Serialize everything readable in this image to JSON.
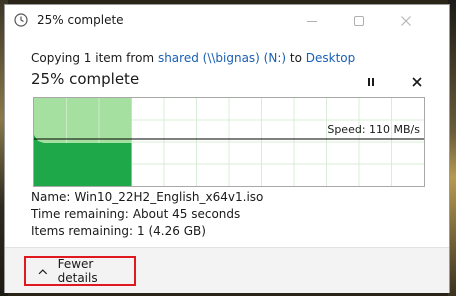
{
  "window": {
    "title": "25% complete",
    "controls": {
      "minimize_icon": "minimize-icon",
      "maximize_icon": "maximize-icon",
      "close_icon": "close-icon"
    }
  },
  "copy": {
    "prefix": "Copying 1 item from ",
    "source": "shared (\\\\bignas) (N:)",
    "middle": " to ",
    "destination": "Desktop",
    "progress_text": "25% complete",
    "progress_fraction": 0.25,
    "pause_icon": "pause-icon",
    "cancel_icon": "cancel-icon"
  },
  "graph": {
    "speed_label": "Speed: 110 MB/s",
    "colors": {
      "done": "#a6e0a0",
      "throughput": "#1ea84a",
      "grid": "#d9ecd7",
      "line": "#000000"
    }
  },
  "details": {
    "name_label": "Name:",
    "name_value": "Win10_22H2_English_x64v1.iso",
    "time_label": "Time remaining:",
    "time_value": "About 45 seconds",
    "items_label": "Items remaining:",
    "items_value": "1 (4.26 GB)"
  },
  "footer": {
    "fewer_details_label": "Fewer details",
    "chevron_icon": "chevron-up-icon",
    "highlight_color": "#e0191e"
  }
}
